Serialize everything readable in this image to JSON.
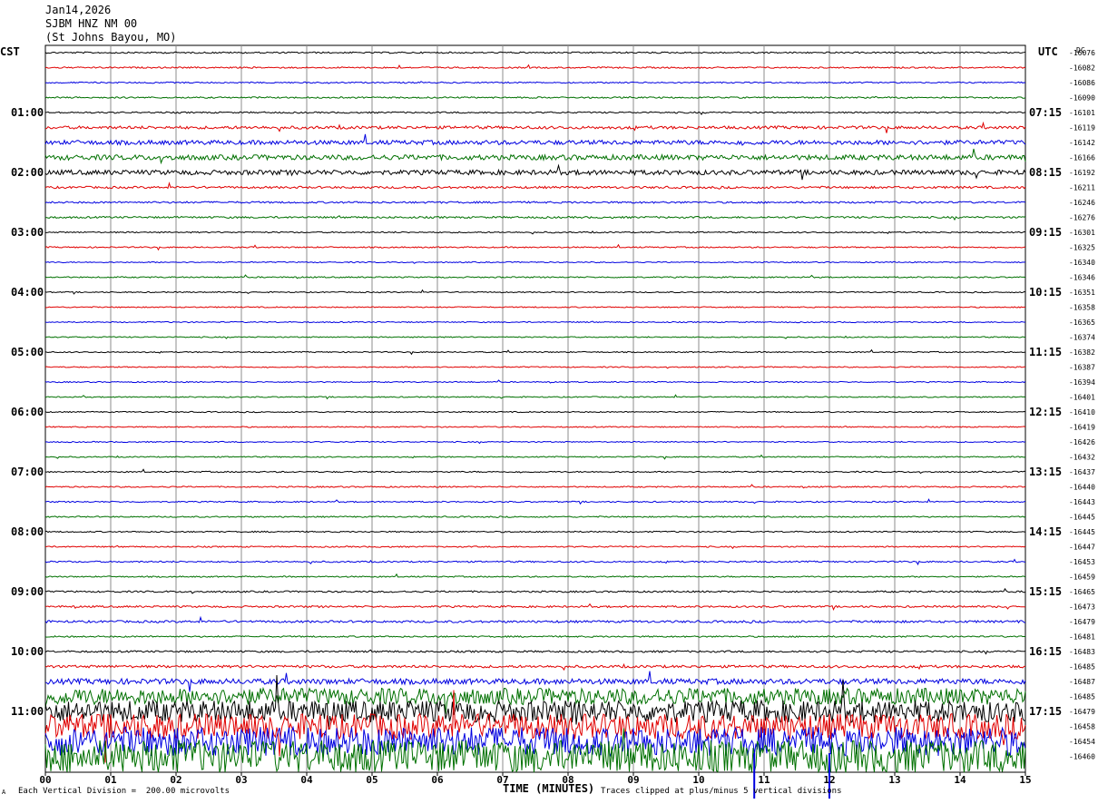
{
  "header": {
    "date": "Jan14,2026",
    "station": "SJBM HNZ NM 00",
    "location": "(St Johns Bayou, MO)"
  },
  "left_axis_title": "CST",
  "right_axis_title": "UTC",
  "dc_label": "DC",
  "footer": {
    "scale_note": "Each Vertical Division =  200.00 microvolts",
    "x_axis_title": "TIME (MINUTES)",
    "clip_note": "Traces clipped at plus/minus 5 vertical divisions",
    "corner_mark": "A"
  },
  "colors": {
    "trace_cycle": [
      "#000000",
      "#e00000",
      "#0000e0",
      "#007000"
    ],
    "grid": "#8c8c8c",
    "event_marker": "#0000e0"
  },
  "chart_data": {
    "type": "line",
    "title": "",
    "xlabel": "TIME (MINUTES)",
    "ylabel": "",
    "xlim": [
      0,
      15
    ],
    "x_ticks": [
      "00",
      "01",
      "02",
      "03",
      "04",
      "05",
      "06",
      "07",
      "08",
      "09",
      "10",
      "11",
      "12",
      "13",
      "14",
      "15"
    ],
    "left_hour_labels": [
      "01:00",
      "02:00",
      "03:00",
      "04:00",
      "05:00",
      "06:00",
      "07:00",
      "08:00",
      "09:00",
      "10:00",
      "11:00"
    ],
    "right_hour_labels": [
      "07:15",
      "08:15",
      "09:15",
      "10:15",
      "11:15",
      "12:15",
      "13:15",
      "14:15",
      "15:15",
      "16:15",
      "17:15"
    ],
    "dc_offsets": [
      -16076,
      -16082,
      -16086,
      -16090,
      -16101,
      -16119,
      -16142,
      -16166,
      -16192,
      -16211,
      -16246,
      -16276,
      -16301,
      -16325,
      -16340,
      -16346,
      -16351,
      -16358,
      -16365,
      -16374,
      -16382,
      -16387,
      -16394,
      -16401,
      -16410,
      -16419,
      -16426,
      -16432,
      -16437,
      -16440,
      -16443,
      -16445,
      -16445,
      -16447,
      -16453,
      -16459,
      -16465,
      -16473,
      -16479,
      -16481,
      -16483,
      -16485,
      -16487,
      -16485,
      -16479,
      -16458,
      -16454,
      -16460
    ],
    "trace_noise_level": [
      0.8,
      0.8,
      0.7,
      0.8,
      0.8,
      1.6,
      2.4,
      2.8,
      2.6,
      1.2,
      1.0,
      1.0,
      0.7,
      0.7,
      0.6,
      0.7,
      0.6,
      0.6,
      0.6,
      0.6,
      0.6,
      0.6,
      0.6,
      0.6,
      0.6,
      0.6,
      0.6,
      0.6,
      0.7,
      0.7,
      0.7,
      0.7,
      0.7,
      0.7,
      0.8,
      0.7,
      0.9,
      1.0,
      1.2,
      0.8,
      1.0,
      1.4,
      3.0,
      9.0,
      12.0,
      14.0,
      16.0,
      18.0
    ],
    "event_marker_minutes": [
      10.85,
      12.0
    ]
  }
}
